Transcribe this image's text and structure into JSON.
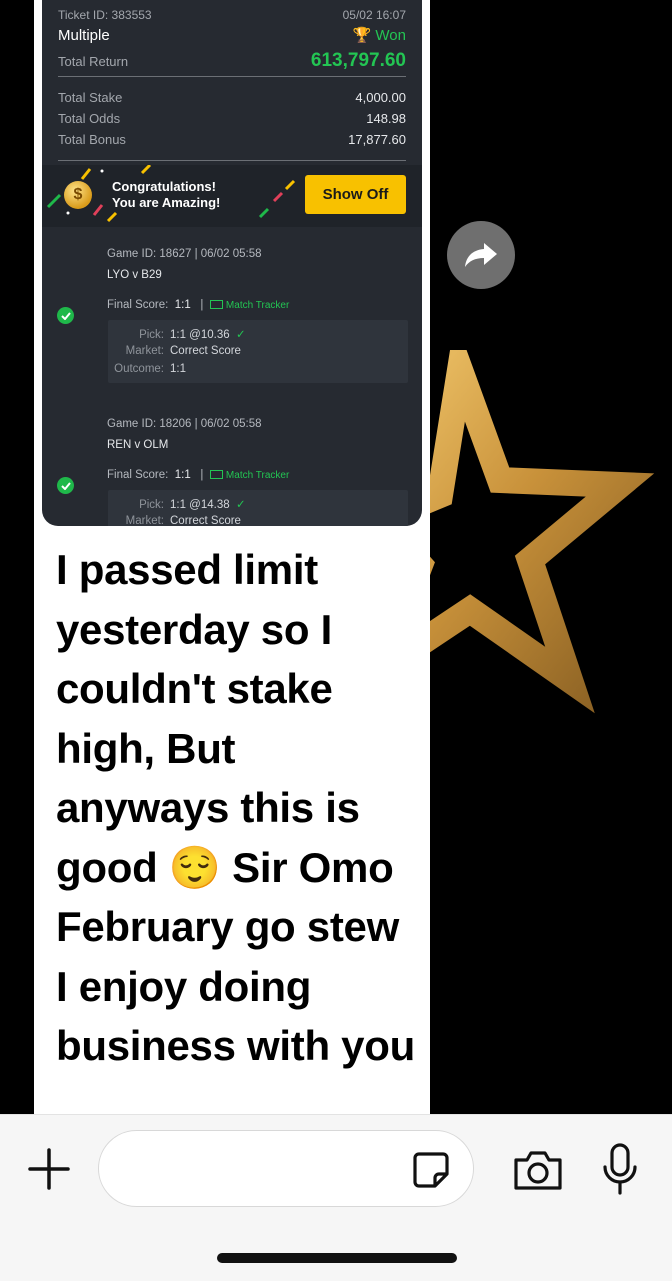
{
  "ticket": {
    "ticket_id": "Ticket ID: 383553",
    "date": "05/02 16:07",
    "bet_type": "Multiple",
    "status": "Won",
    "total_return_label": "Total Return",
    "total_return": "613,797.60",
    "total_stake_label": "Total Stake",
    "total_stake": "4,000.00",
    "total_odds_label": "Total Odds",
    "total_odds": "148.98",
    "total_bonus_label": "Total Bonus",
    "total_bonus": "17,877.60",
    "congrats_line1": "Congratulations!",
    "congrats_line2": "You are Amazing!",
    "show_off_label": "Show Off",
    "coin_symbol": "$"
  },
  "games": [
    {
      "game_id": "Game ID: 18627 | 06/02 05:58",
      "teams": "LYO v B29",
      "final_score_label": "Final Score:",
      "final_score": "1:1",
      "tracker_label": "Match Tracker",
      "pick_label": "Pick:",
      "pick": "1:1 @10.36",
      "market_label": "Market:",
      "market": "Correct Score",
      "outcome_label": "Outcome:",
      "outcome": "1:1"
    },
    {
      "game_id": "Game ID: 18206 | 06/02 05:58",
      "teams": "REN v OLM",
      "final_score_label": "Final Score:",
      "final_score": "1:1",
      "tracker_label": "Match Tracker",
      "pick_label": "Pick:",
      "pick": "1:1 @14.38",
      "market_label": "Market:",
      "market": "Correct Score"
    }
  ],
  "message": {
    "text_before_emoji": "I passed limit yesterday so I couldn't stake high, But anyways this is good ",
    "emoji": "😌",
    "text_after_emoji": " Sir Omo February go stew I enjoy doing business with you"
  },
  "input_bar": {
    "placeholder": "",
    "icons": [
      "plus-icon",
      "sticker-icon",
      "camera-icon",
      "microphone-icon"
    ]
  },
  "colors": {
    "won_green": "#23c553",
    "show_off_yellow": "#f8c100",
    "ticket_bg": "#262a31",
    "star_gold": "#d4a54a"
  }
}
